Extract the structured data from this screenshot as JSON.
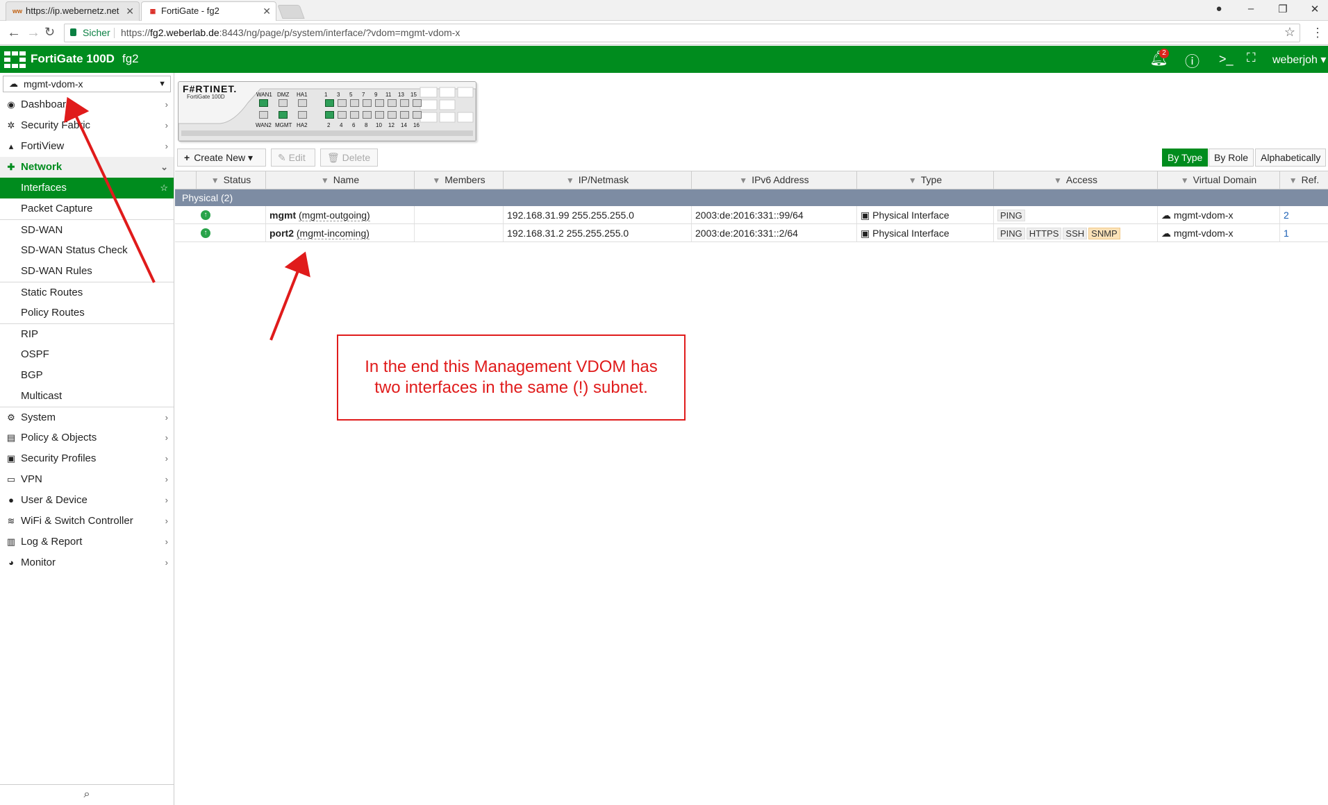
{
  "browser": {
    "tabs": [
      {
        "favicon": "ww",
        "title": "https://ip.webernetz.net",
        "close": "✕"
      },
      {
        "favicon": "F",
        "title": "FortiGate - fg2",
        "close": "✕"
      }
    ],
    "secure_label": "Sicher",
    "url_prefix": "https://",
    "url_host": "fg2.weberlab.de",
    "url_rest": ":8443/ng/page/p/system/interface/?vdom=mgmt-vdom-x"
  },
  "header": {
    "model": "FortiGate 100D",
    "hostname": "fg2",
    "notification_count": "2",
    "user": "weberjoh"
  },
  "sidebar": {
    "vdom_selected": "mgmt-vdom-x",
    "items": [
      {
        "label": "Dashboard",
        "icon": "dashboard-icon"
      },
      {
        "label": "Security Fabric",
        "icon": "fabric-icon"
      },
      {
        "label": "FortiView",
        "icon": "chart-icon"
      },
      {
        "label": "Network",
        "icon": "network-icon"
      },
      {
        "label": "Interfaces"
      },
      {
        "label": "Packet Capture"
      },
      {
        "label": "SD-WAN"
      },
      {
        "label": "SD-WAN Status Check"
      },
      {
        "label": "SD-WAN Rules"
      },
      {
        "label": "Static Routes"
      },
      {
        "label": "Policy Routes"
      },
      {
        "label": "RIP"
      },
      {
        "label": "OSPF"
      },
      {
        "label": "BGP"
      },
      {
        "label": "Multicast"
      },
      {
        "label": "System",
        "icon": "gear-icon"
      },
      {
        "label": "Policy & Objects",
        "icon": "clipboard-icon"
      },
      {
        "label": "Security Profiles",
        "icon": "lock-icon"
      },
      {
        "label": "VPN",
        "icon": "laptop-icon"
      },
      {
        "label": "User & Device",
        "icon": "user-icon"
      },
      {
        "label": "WiFi & Switch Controller",
        "icon": "wifi-icon"
      },
      {
        "label": "Log & Report",
        "icon": "bar-chart-icon"
      },
      {
        "label": "Monitor",
        "icon": "pie-icon"
      }
    ]
  },
  "device": {
    "brand": "F#RTINET.",
    "model": "FortiGate 100D",
    "top_labels": [
      "WAN1",
      "DMZ",
      "HA1",
      "1",
      "3",
      "5",
      "7",
      "9",
      "11",
      "13",
      "15"
    ],
    "bottom_labels": [
      "WAN2",
      "MGMT",
      "HA2",
      "2",
      "4",
      "6",
      "8",
      "10",
      "12",
      "14",
      "16"
    ]
  },
  "toolbar": {
    "create_new": "Create New",
    "edit": "Edit",
    "delete": "Delete",
    "views": [
      "By Type",
      "By Role",
      "Alphabetically"
    ],
    "selected_view": "By Type"
  },
  "table": {
    "columns": [
      "Status",
      "Name",
      "Members",
      "IP/Netmask",
      "IPv6 Address",
      "Type",
      "Access",
      "Virtual Domain",
      "Ref."
    ],
    "group_label": "Physical (2)",
    "rows": [
      {
        "status": "up",
        "name": "mgmt",
        "alias": "(mgmt-outgoing)",
        "members": "",
        "ip": "192.168.31.99 255.255.255.0",
        "ipv6": "2003:de:2016:331::99/64",
        "type": "Physical Interface",
        "access": [
          "PING"
        ],
        "vdom": "mgmt-vdom-x",
        "ref": "2"
      },
      {
        "status": "up",
        "name": "port2",
        "alias": "(mgmt-incoming)",
        "members": "",
        "ip": "192.168.31.2 255.255.255.0",
        "ipv6": "2003:de:2016:331::2/64",
        "type": "Physical Interface",
        "access": [
          "PING",
          "HTTPS",
          "SSH",
          "SNMP"
        ],
        "vdom": "mgmt-vdom-x",
        "ref": "1"
      }
    ]
  },
  "annotation": {
    "line1": "In the end this Management VDOM has",
    "line2": "two interfaces in the same (!) subnet.",
    "color": "#e01b1b"
  },
  "colors": {
    "brand_green": "#008c1e",
    "group_row": "#7d8ca3",
    "status_up": "#29a34a"
  }
}
